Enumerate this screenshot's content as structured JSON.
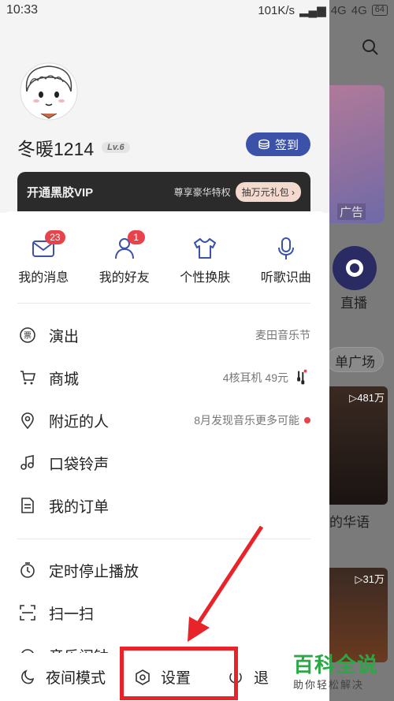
{
  "status_bar": {
    "time": "10:33",
    "network_speed": "101K/s",
    "signal1": "4G",
    "signal2": "4G",
    "battery": "64"
  },
  "background": {
    "ad_label": "广告",
    "live_label": "直播",
    "square_label": "单广场",
    "card1_count": "▷481万",
    "section_label": "的华语",
    "card2_count": "▷31万"
  },
  "profile": {
    "username": "冬暖1214",
    "level": "Lv.6",
    "signin_label": "签到"
  },
  "vip": {
    "title": "开通黑胶VIP",
    "tip": "尊享豪华特权",
    "gift": "抽万元礼包 ›"
  },
  "quick": [
    {
      "label": "我的消息",
      "badge": "23",
      "icon": "mail-icon"
    },
    {
      "label": "我的好友",
      "badge": "1",
      "icon": "user-icon"
    },
    {
      "label": "个性换肤",
      "badge": "",
      "icon": "shirt-icon"
    },
    {
      "label": "听歌识曲",
      "badge": "",
      "icon": "mic-icon"
    }
  ],
  "menu1": [
    {
      "label": "演出",
      "extra": "麦田音乐节",
      "icon": "ticket-icon"
    },
    {
      "label": "商城",
      "extra": "4核耳机 49元",
      "icon": "cart-icon"
    },
    {
      "label": "附近的人",
      "extra": "8月发现音乐更多可能",
      "icon": "location-icon"
    },
    {
      "label": "口袋铃声",
      "extra": "",
      "icon": "music-note-icon"
    },
    {
      "label": "我的订单",
      "extra": "",
      "icon": "order-icon"
    }
  ],
  "menu2": [
    {
      "label": "定时停止播放",
      "icon": "timer-icon"
    },
    {
      "label": "扫一扫",
      "icon": "scan-icon"
    },
    {
      "label": "音乐闹钟",
      "icon": "alarm-icon"
    }
  ],
  "bottom": {
    "night_mode": "夜间模式",
    "settings": "设置",
    "exit": "退"
  },
  "watermark": {
    "big": "百科全说",
    "small": "助你轻松解决"
  },
  "colors": {
    "accent": "#3b52a8",
    "badge": "#e8434b",
    "highlight": "#e8232a",
    "watermark": "#2aa845"
  }
}
